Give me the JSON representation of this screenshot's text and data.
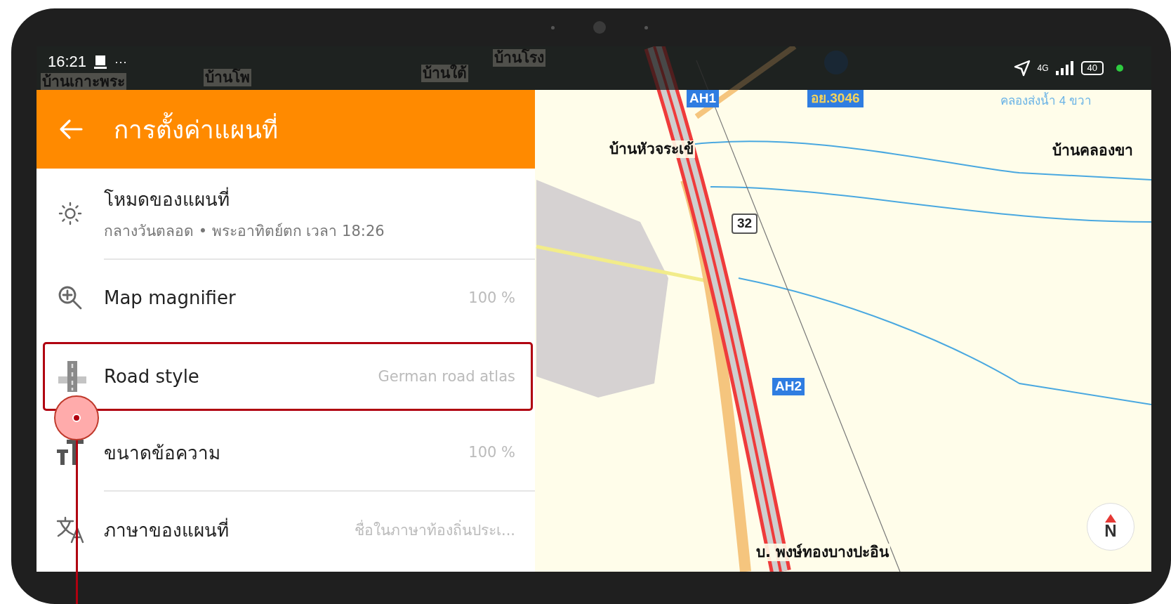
{
  "status_bar": {
    "time": "16:21",
    "more": "···",
    "network": "4G",
    "battery": "40"
  },
  "header": {
    "title": "การตั้งค่าแผนที่"
  },
  "sections": [
    {
      "rows": [
        {
          "kind": "mode",
          "title": "โหมดของแผนที่",
          "subtitle": "กลางวันตลอด • พระอาทิตย์ตก เวลา 18:26",
          "highlighted": false
        }
      ]
    },
    {
      "rows": [
        {
          "kind": "magnifier",
          "title": "Map magnifier",
          "value": "100 %",
          "highlighted": false
        },
        {
          "kind": "road",
          "title": "Road style",
          "value": "German road atlas",
          "highlighted": true
        },
        {
          "kind": "text-size",
          "title": "ขนาดข้อความ",
          "value": "100 %",
          "highlighted": false
        }
      ]
    },
    {
      "rows": [
        {
          "kind": "language",
          "title": "ภาษาของแผนที่",
          "value": "ชื่อในภาษาท้องถิ่นประเ...",
          "highlighted": false
        }
      ]
    }
  ],
  "map": {
    "labels": [
      {
        "kind": "place",
        "text": "บ้านเกาะพระ"
      },
      {
        "kind": "place",
        "text": "บ้านโพ"
      },
      {
        "kind": "place",
        "text": "บ้านใต้"
      },
      {
        "kind": "place",
        "text": "บ้านโรง"
      },
      {
        "kind": "route",
        "text": "AH1"
      },
      {
        "kind": "ref",
        "text": "อย.3046"
      },
      {
        "kind": "water",
        "text": "คลองส่งน้ำ 4 ขวา"
      },
      {
        "kind": "place",
        "text": "บ้านหัวจระเข้"
      },
      {
        "kind": "place",
        "text": "บ้านคลองขา"
      },
      {
        "kind": "shield",
        "text": "32"
      },
      {
        "kind": "route",
        "text": "AH2"
      },
      {
        "kind": "place",
        "text": "บ. พงษ์ทองบางปะอิน"
      }
    ],
    "compass": "N"
  }
}
